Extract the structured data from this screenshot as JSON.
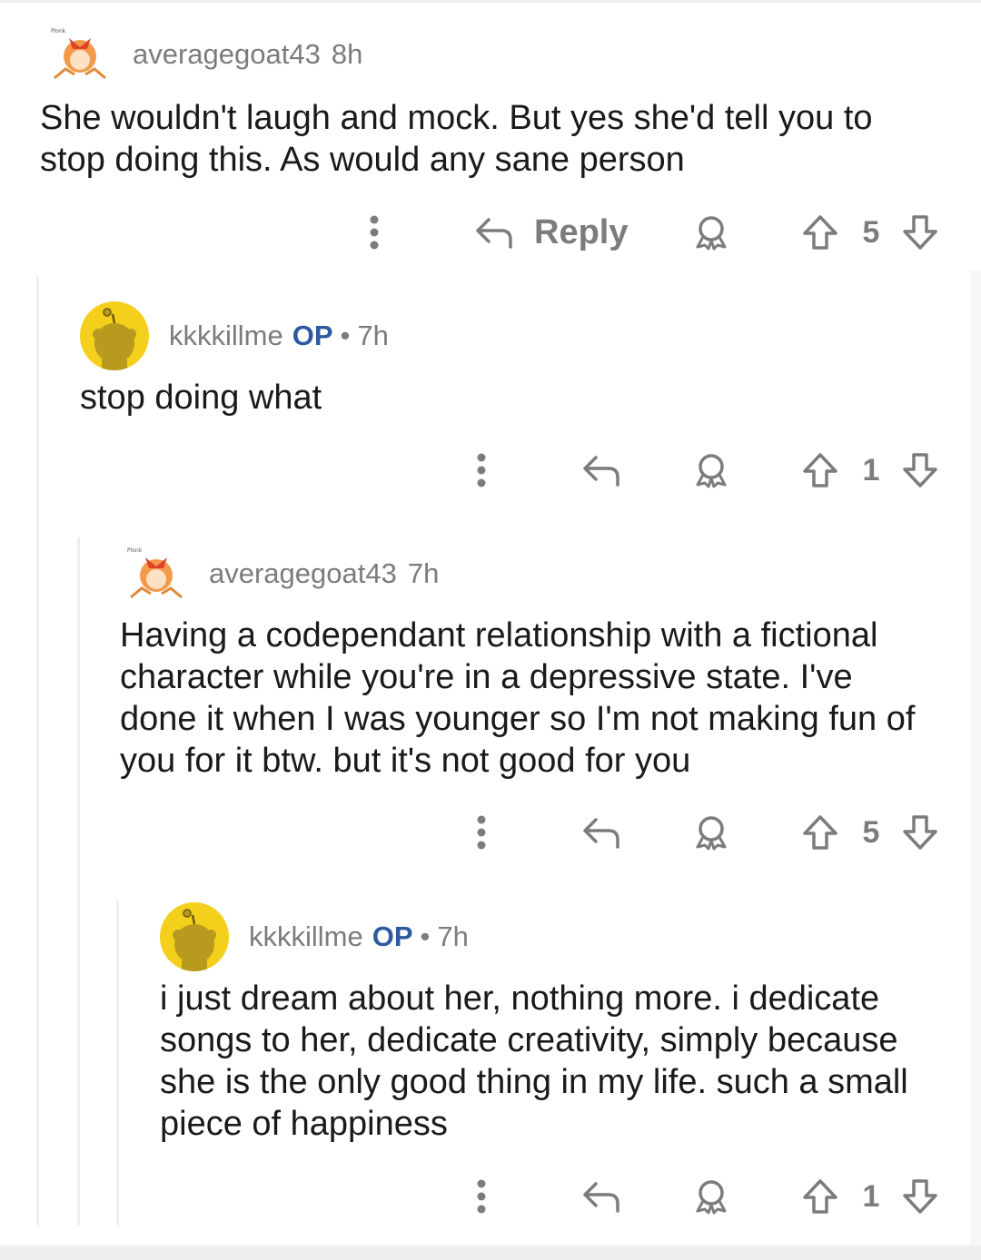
{
  "comments": [
    {
      "username": "averagegoat43",
      "op_badge": "",
      "time": "8h",
      "body": "She wouldn't laugh and mock. But yes she'd tell you to stop doing this. As would any sane person",
      "reply_label": "Reply",
      "votes": "5",
      "avatar": "anime-girl-avatar"
    },
    {
      "username": "kkkkillme",
      "op_badge": "OP",
      "separator": "•",
      "time": "7h",
      "body": "stop doing what",
      "votes": "1",
      "avatar": "snoo-avatar"
    },
    {
      "username": "averagegoat43",
      "op_badge": "",
      "time": "7h",
      "body": "Having a codependant relationship with a fictional character while you're in a depressive state. I've done it when I was younger so I'm not making fun of you for it btw. but it's not good for you",
      "votes": "5",
      "avatar": "anime-girl-avatar"
    },
    {
      "username": "kkkkillme",
      "op_badge": "OP",
      "separator": "•",
      "time": "7h",
      "body": "i just dream about her, nothing more. i dedicate songs to her, dedicate creativity, simply because she is the only good thing in my life. such a small piece of happiness",
      "votes": "1",
      "avatar": "snoo-avatar"
    }
  ],
  "colors": {
    "text": "#1a1a1b",
    "meta": "#7c7c7c",
    "op": "#2d5a9e",
    "snoo_bg": "#f4cf1c",
    "thread_line": "#edeff1"
  }
}
